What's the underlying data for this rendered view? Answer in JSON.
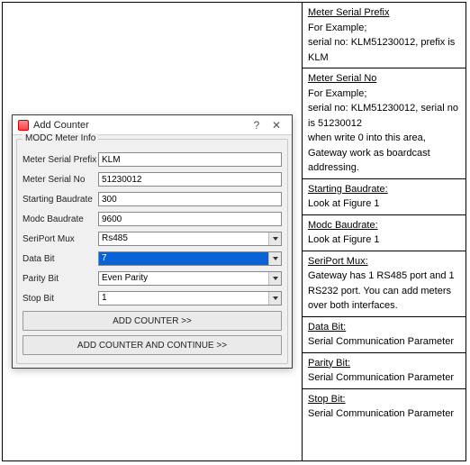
{
  "dialog": {
    "title": "Add Counter",
    "group_legend": "MODC Meter Info",
    "fields": {
      "prefix_label": "Meter Serial Prefix",
      "prefix_value": "KLM",
      "serial_label": "Meter Serial No",
      "serial_value": "51230012",
      "startbaud_label": "Starting Baudrate",
      "startbaud_value": "300",
      "modcbaud_label": "Modc Baudrate",
      "modcbaud_value": "9600",
      "seriport_label": "SeriPort Mux",
      "seriport_value": "Rs485",
      "databit_label": "Data Bit",
      "databit_value": "7",
      "parity_label": "Parity Bit",
      "parity_value": "Even Parity",
      "stopbit_label": "Stop Bit",
      "stopbit_value": "1"
    },
    "btn_add": "ADD COUNTER >>",
    "btn_add_continue": "ADD COUNTER AND CONTINUE >>"
  },
  "help": {
    "r1_title": "Meter Serial Prefix",
    "r1_l1": "For Example;",
    "r1_l2": "serial no: KLM51230012, prefix is KLM",
    "r2_title": "Meter Serial No",
    "r2_l1": "For Example;",
    "r2_l2": "serial no: KLM51230012, serial no is 51230012",
    "r2_l3": "when write 0 into this area, Gateway work as boardcast addressing.",
    "r3_title": "Starting Baudrate:",
    "r3_l1": "Look at Figure 1",
    "r4_title": "Modc Baudrate:",
    "r4_l1": "Look at Figure 1",
    "r5_title": "SeriPort Mux:",
    "r5_l1": "Gateway has 1 RS485 port and 1 RS232 port. You can add meters over both interfaces.",
    "r6_title": "Data Bit:",
    "r6_l1": "Serial Communication Parameter",
    "r7_title": "Parity Bit:",
    "r7_l1": "Serial Communication Parameter",
    "r8_title": "Stop Bit:",
    "r8_l1": "Serial Communication Parameter"
  }
}
